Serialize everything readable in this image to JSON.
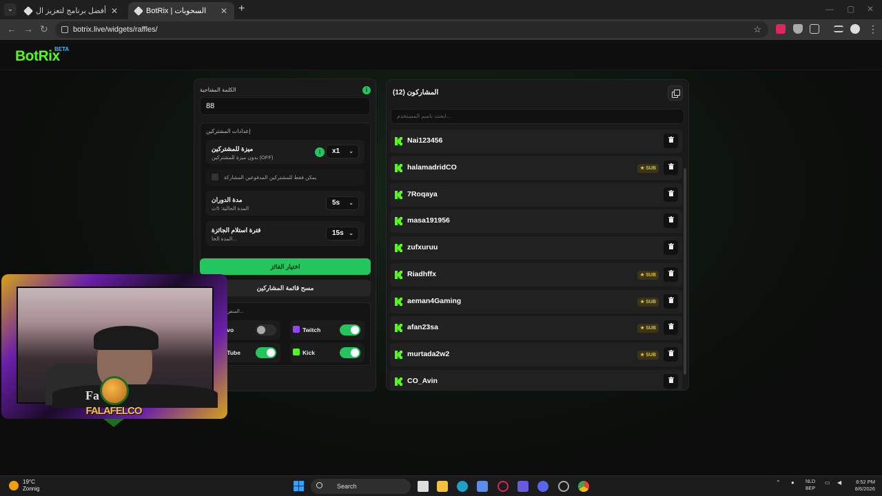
{
  "browser": {
    "tabs": [
      {
        "title": "الويدجتات | أفضل برنامج لتعزيز ال..."
      },
      {
        "title": "BotRix | السحوبات"
      }
    ],
    "new_tab": "+",
    "url": "botrix.live/widgets/raffles/"
  },
  "app": {
    "logo": "BotRix",
    "beta": "BETA"
  },
  "settings": {
    "keyword_label": "الكلمة المفتاحية",
    "keyword_value": "88",
    "participants_settings": "إعدادات المشتركين",
    "sub_advantage_title": "ميزة للمشتركين",
    "sub_advantage_desc": "بدون ميزة للمشتركين (OFF)",
    "multiplier": "x1",
    "only_paid_label": "يمكن فقط للمشتركين المدفوعين المشاركة",
    "spin_duration_title": "مدة الدوران",
    "spin_duration_desc": "المدة الحالية: 5ث",
    "spin_duration_value": "5s",
    "claim_period_title": "فترة استلام الجائزة",
    "claim_period_desc": "المدة الحا...",
    "claim_period_value": "15s",
    "pick_winner": "اختيار الفائز",
    "clear_participants": "مسح قائمة المشاركين",
    "platforms_label": "المنص...",
    "platforms": [
      {
        "name": "...ovo",
        "enabled": false
      },
      {
        "name": "Twitch",
        "enabled": true
      },
      {
        "name": "...uTube",
        "enabled": true
      },
      {
        "name": "Kick",
        "enabled": true
      }
    ]
  },
  "participants": {
    "title": "المشاركون (12)",
    "search_placeholder": "ابحث باسم المستخدم...",
    "sub_badge": "SUB",
    "list": [
      {
        "name": "Nai123456",
        "sub": false
      },
      {
        "name": "halamadridCO",
        "sub": true
      },
      {
        "name": "7Roqaya",
        "sub": false
      },
      {
        "name": "masa191956",
        "sub": false
      },
      {
        "name": "zufxuruu",
        "sub": false
      },
      {
        "name": "Riadhffx",
        "sub": true
      },
      {
        "name": "aeman4Gaming",
        "sub": true
      },
      {
        "name": "afan23sa",
        "sub": true
      },
      {
        "name": "murtada2w2",
        "sub": true
      },
      {
        "name": "CO_Avin",
        "sub": false
      }
    ]
  },
  "webcam": {
    "badge_text": "FALAFELCO",
    "shirt_text": "Fa"
  },
  "taskbar": {
    "weather_temp": "19°C",
    "weather_desc": "Zonnig",
    "search": "Search",
    "lang_top": "NLD",
    "lang_bottom": "BEP",
    "time": "8:52 PM",
    "date": "8/6/2026"
  },
  "colors": {
    "accent": "#22c55e",
    "kick": "#53fc18",
    "twitch": "#9146ff",
    "sub_badge": "#e5c234"
  }
}
